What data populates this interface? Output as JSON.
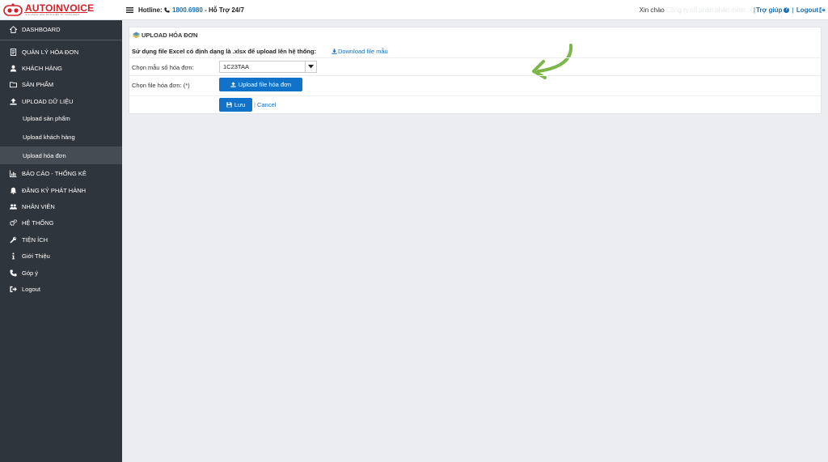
{
  "header": {
    "logo_auto": "AUTO",
    "logo_invoice": "INVOICE",
    "logo_tagline": "GIẢI PHÁP HÓA ĐƠN ĐIỆN TỬ TOÀN DIỆN",
    "hotline_label": "Hotline:",
    "hotline_number": "1800.6980",
    "support_text": "- Hỗ Trợ 24/7",
    "greeting": "Xin chào",
    "user_name": "Công ty cổ phần phần mềm ...",
    "help_label": "Trợ giúp",
    "logout_label": "Logout"
  },
  "sidebar": {
    "items": [
      {
        "label": "DASHBOARD",
        "icon": "home-icon"
      },
      {
        "label": "QUẢN LÝ HÓA ĐƠN",
        "icon": "invoice-icon"
      },
      {
        "label": "KHÁCH HÀNG",
        "icon": "user-icon"
      },
      {
        "label": "SẢN PHẨM",
        "icon": "folder-icon"
      },
      {
        "label": "UPLOAD DỮ LIỆU",
        "icon": "upload-icon"
      },
      {
        "label": "BÁO CÁO - THỐNG KÊ",
        "icon": "chart-icon"
      },
      {
        "label": "ĐĂNG KÝ PHÁT HÀNH",
        "icon": "bell-icon"
      },
      {
        "label": "NHÂN VIÊN",
        "icon": "users-icon"
      },
      {
        "label": "HỆ THỐNG",
        "icon": "gears-icon"
      },
      {
        "label": "TIỆN ÍCH",
        "icon": "wrench-icon"
      },
      {
        "label": "Giới Thiệu",
        "icon": "info-icon"
      },
      {
        "label": "Góp ý",
        "icon": "phone-icon"
      },
      {
        "label": "Logout",
        "icon": "signout-icon"
      }
    ],
    "sub_items": [
      {
        "label": "Upload sản phẩm"
      },
      {
        "label": "Upload khách hàng"
      },
      {
        "label": "Upload hóa đơn"
      }
    ]
  },
  "main": {
    "title": "UPLOAD HÓA ĐƠN",
    "instruction": "Sử dụng file Excel có định dạng là .xlsx để upload lên hệ thống:",
    "download_label": "Download file mẫu",
    "template_label": "Chọn mẫu số hóa đơn:",
    "template_value": "1C23TAA",
    "file_label": "Chọn file hóa đơn: (*)",
    "upload_button": "Upload file hóa đơn",
    "save_button": "Lưu",
    "cancel_link": "Cancel"
  },
  "colors": {
    "sidebar_bg": "#2f353c",
    "accent_blue": "#1072c9",
    "link_blue": "#1a6fb5",
    "arrow_green": "#7ab648",
    "brand_red": "#d32029"
  }
}
